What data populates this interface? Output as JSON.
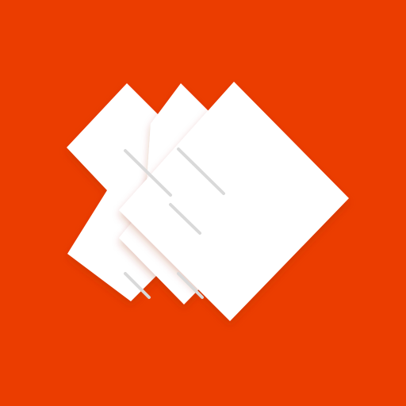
{
  "icon": {
    "name": "stacked-diamond-cards-logo",
    "colors": {
      "background": "#EB3D00",
      "card": "#FFFFFF",
      "shadow": "#9E2A00"
    }
  }
}
